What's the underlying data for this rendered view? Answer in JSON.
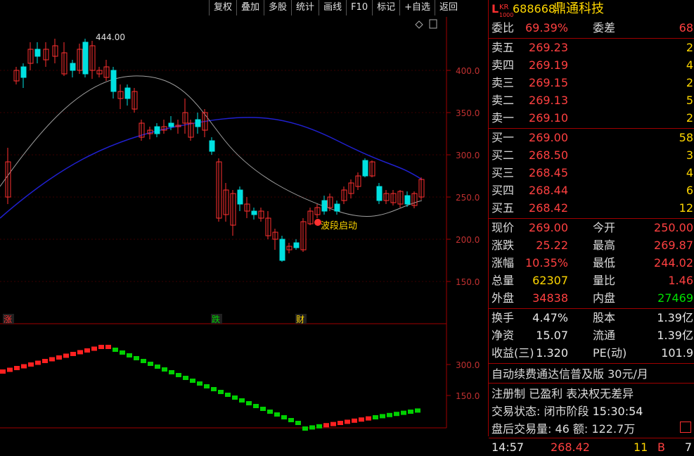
{
  "toolbar": [
    "复权",
    "叠加",
    "多股",
    "统计",
    "画线",
    "F10",
    "标记",
    "+自选",
    "返回"
  ],
  "header": {
    "badge_l": "L",
    "badge_kr": "KR",
    "badge_num": "1000",
    "code": "688668",
    "name": "鼎通科技"
  },
  "main_chart": {
    "y_ticks": [
      "400.0",
      "350.0",
      "300.0",
      "250.0",
      "200.0",
      "150.0"
    ],
    "max_label": "444.00",
    "annotation": "波段启动",
    "markers": [
      "涨",
      "跌",
      "财"
    ]
  },
  "sub_chart": {
    "y_ticks": [
      "300.0",
      "150.0"
    ]
  },
  "quote": {
    "weibi": {
      "label": "委比",
      "value": "69.39%",
      "label2": "委差",
      "value2": "68"
    },
    "asks": [
      {
        "label": "卖五",
        "price": "269.23",
        "vol": "2"
      },
      {
        "label": "卖四",
        "price": "269.19",
        "vol": "4"
      },
      {
        "label": "卖三",
        "price": "269.15",
        "vol": "2"
      },
      {
        "label": "卖二",
        "price": "269.13",
        "vol": "5"
      },
      {
        "label": "卖一",
        "price": "269.10",
        "vol": "2"
      }
    ],
    "bids": [
      {
        "label": "买一",
        "price": "269.00",
        "vol": "58"
      },
      {
        "label": "买二",
        "price": "268.50",
        "vol": "3"
      },
      {
        "label": "买三",
        "price": "268.45",
        "vol": "4"
      },
      {
        "label": "买四",
        "price": "268.44",
        "vol": "6"
      },
      {
        "label": "买五",
        "price": "268.42",
        "vol": "12"
      }
    ],
    "stats1": [
      {
        "l1": "现价",
        "v1": "269.00",
        "l2": "今开",
        "v2": "250.00"
      },
      {
        "l1": "涨跌",
        "v1": "25.22",
        "l2": "最高",
        "v2": "269.87"
      },
      {
        "l1": "涨幅",
        "v1": "10.35%",
        "l2": "最低",
        "v2": "244.02"
      },
      {
        "l1": "总量",
        "v1": "62307",
        "l2": "量比",
        "v2": "1.46"
      },
      {
        "l1": "外盘",
        "v1": "34838",
        "l2": "内盘",
        "v2": "27469"
      }
    ],
    "stats2": [
      {
        "l1": "换手",
        "v1": "4.47%",
        "l2": "股本",
        "v2": "1.39亿"
      },
      {
        "l1": "净资",
        "v1": "15.07",
        "l2": "流通",
        "v2": "1.39亿"
      },
      {
        "l1": "收益(三)",
        "v1": "1.320",
        "l2": "PE(动)",
        "v2": "101.9"
      }
    ],
    "promo": "自动续费通达信普及版  30元/月",
    "info1": "注册制 已盈利 表决权无差异",
    "info2_label": "交易状态:",
    "info2_value": "闭市阶段",
    "info2_time": "15:30:54",
    "info3": "盘后交易量: 46  额: 122.7万",
    "tick": {
      "time": "14:57",
      "price": "268.42",
      "vol": "11",
      "side": "B",
      "extra": "7"
    }
  }
}
